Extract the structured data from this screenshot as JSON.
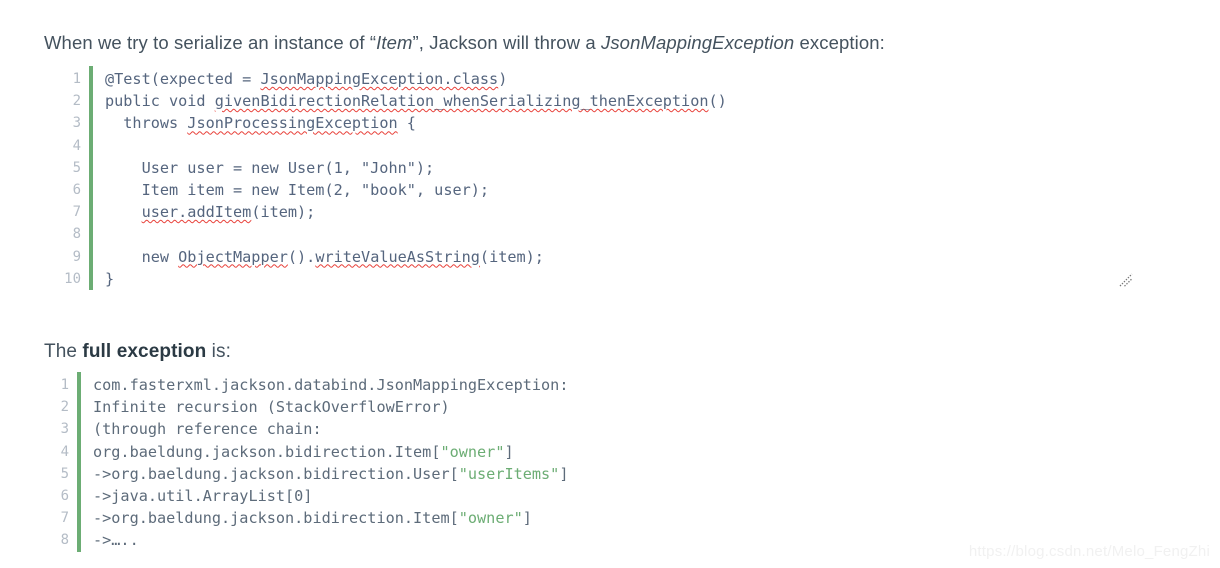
{
  "intro": {
    "part1": "When we try to serialize an instance of “",
    "italic1": "Item",
    "part2": "”, Jackson will throw a ",
    "italic2": "JsonMappingException",
    "part3": " exception:"
  },
  "full_exception_heading": {
    "part1": "The ",
    "bold": "full exception",
    "part2": " is:"
  },
  "code_block_serialize": {
    "name": "serialize-test-code",
    "language": "java",
    "line_numbers": [
      "1",
      "2",
      "3",
      "4",
      "5",
      "6",
      "7",
      "8",
      "9",
      "10"
    ],
    "lines": [
      "@Test(expected = JsonMappingException.class)",
      "public void givenBidirectionRelation_whenSerializing_thenException()",
      "  throws JsonProcessingException {",
      "",
      "    User user = new User(1, \"John\");",
      "    Item item = new Item(2, \"book\", user);",
      "    user.addItem(item);",
      "",
      "    new ObjectMapper().writeValueAsString(item);",
      "}"
    ]
  },
  "code_block_exception": {
    "name": "exception-stacktrace-code",
    "language": "text",
    "line_numbers": [
      "1",
      "2",
      "3",
      "4",
      "5",
      "6",
      "7",
      "8"
    ],
    "lines": [
      "com.fasterxml.jackson.databind.JsonMappingException:",
      "Infinite recursion (StackOverflowError)",
      "(through reference chain:",
      "org.baeldung.jackson.bidirection.Item[\"owner\"]",
      "->org.baeldung.jackson.bidirection.User[\"userItems\"]",
      "->java.util.ArrayList[0]",
      "->org.baeldung.jackson.bidirection.Item[\"owner\"]",
      "->….."
    ]
  },
  "watermark": {
    "text": "https://blog.csdn.net/Melo_FengZhi"
  },
  "colors": {
    "accent_green": "#6cad74",
    "code_text": "#55657e",
    "string_literal": "#6cad74",
    "line_number": "#b4bcc6",
    "prose_text": "#44525e",
    "spellcheck_underline": "#e8413a",
    "watermark": "#f1f1f1",
    "background": "#ffffff"
  },
  "resize_grip": {
    "name": "resize-grip"
  }
}
